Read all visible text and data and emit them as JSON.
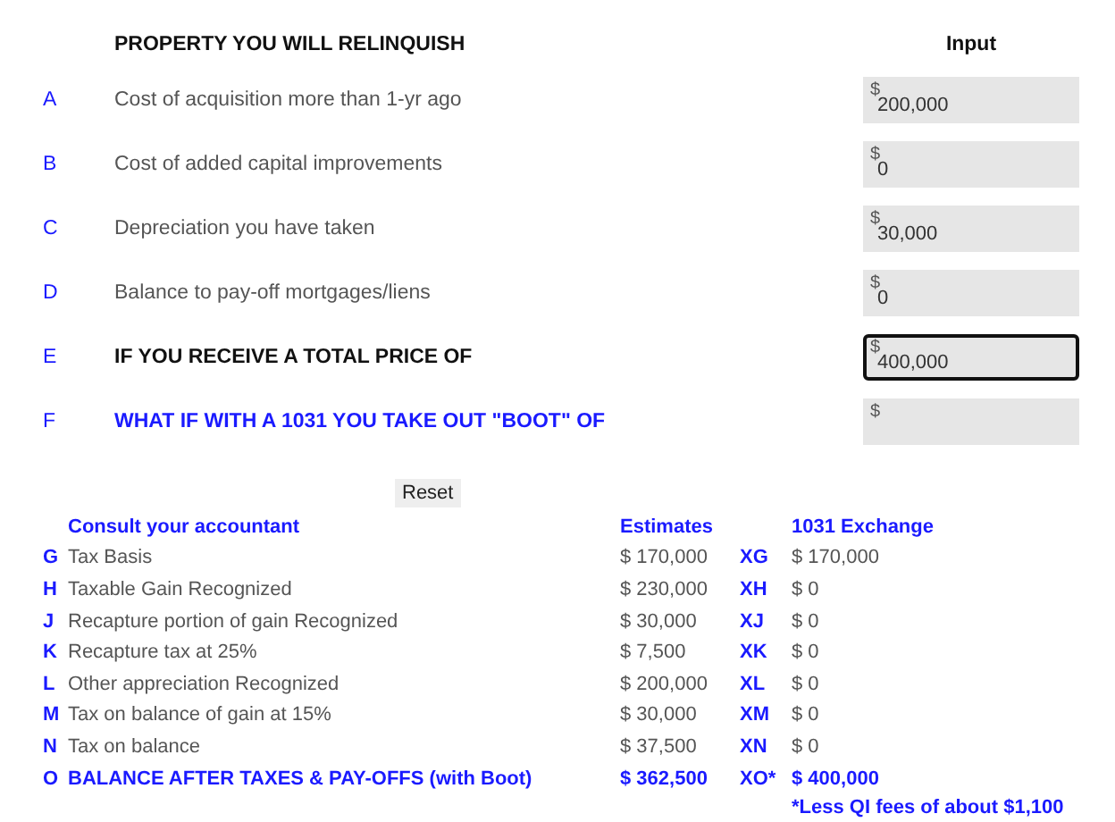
{
  "inputs_header": {
    "title": "PROPERTY YOU WILL RELINQUISH",
    "column": "Input"
  },
  "inputs": [
    {
      "letter": "A",
      "label": "Cost of acquisition more than 1-yr ago",
      "kind": "plain",
      "currency": "$",
      "value": "200,000",
      "focused": false
    },
    {
      "letter": "B",
      "label": "Cost of added capital improvements",
      "kind": "plain",
      "currency": "$",
      "value": "0",
      "focused": false
    },
    {
      "letter": "C",
      "label": "Depreciation you have taken",
      "kind": "plain",
      "currency": "$",
      "value": "30,000",
      "focused": false
    },
    {
      "letter": "D",
      "label": "Balance to pay-off mortgages/liens",
      "kind": "plain",
      "currency": "$",
      "value": "0",
      "focused": false
    },
    {
      "letter": "E",
      "label": "IF YOU RECEIVE A TOTAL PRICE OF",
      "kind": "bold",
      "currency": "$",
      "value": "400,000",
      "focused": true
    },
    {
      "letter": "F",
      "label": "WHAT IF WITH A 1031 YOU TAKE OUT \"BOOT\" OF",
      "kind": "highlight",
      "currency": "$",
      "focused": false
    }
  ],
  "reset_button": "Reset",
  "results_header": {
    "title": "Consult your accountant",
    "estimates": "Estimates",
    "exchange": "1031 Exchange"
  },
  "results": [
    {
      "letter": "G",
      "label": "Tax Basis",
      "estimate": "$ 170,000",
      "code": "XG",
      "exchange": "$ 170,000",
      "kind": "normal"
    },
    {
      "letter": "H",
      "label": "Taxable Gain Recognized",
      "estimate": "$ 230,000",
      "code": "XH",
      "exchange": "$ 0",
      "kind": "normal"
    },
    {
      "letter": "J",
      "label": "Recapture portion of gain Recognized",
      "estimate": "$ 30,000",
      "code": "XJ",
      "exchange": "$ 0",
      "kind": "normal"
    },
    {
      "letter": "K",
      "label": "Recapture tax at 25%",
      "estimate": "$ 7,500",
      "code": "XK",
      "exchange": "$ 0",
      "kind": "normal"
    },
    {
      "letter": "L",
      "label": "Other appreciation Recognized",
      "estimate": "$ 200,000",
      "code": "XL",
      "exchange": "$ 0",
      "kind": "normal"
    },
    {
      "letter": "M",
      "label": "Tax on balance of gain at 15%",
      "estimate": "$ 30,000",
      "code": "XM",
      "exchange": "$ 0",
      "kind": "normal"
    },
    {
      "letter": "N",
      "label": "Tax on balance",
      "estimate": "$ 37,500",
      "code": "XN",
      "exchange": "$ 0",
      "kind": "normal"
    },
    {
      "letter": "O",
      "label": "BALANCE AFTER TAXES & PAY-OFFS (with Boot)",
      "estimate": "$ 362,500",
      "code": "XO*",
      "exchange": "$ 400,000",
      "kind": "total"
    }
  ],
  "footnote": "*Less QI fees of about $1,100"
}
